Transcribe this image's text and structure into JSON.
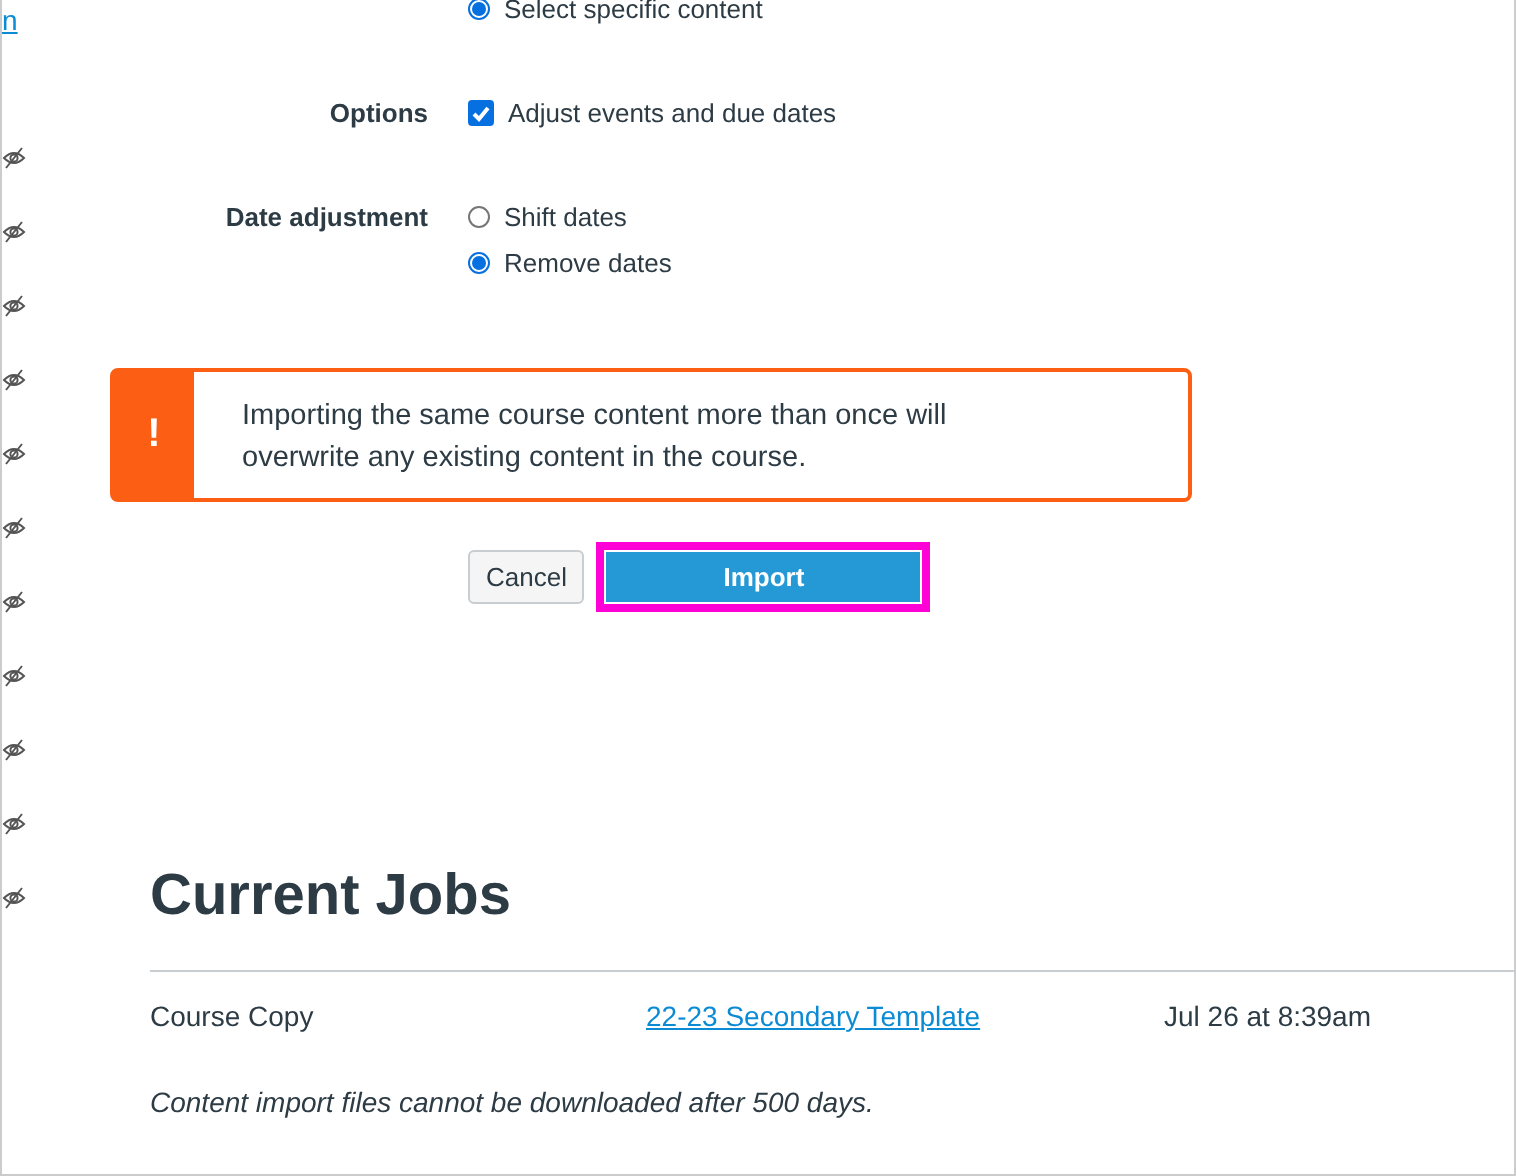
{
  "sidebar": {
    "link": "n",
    "items": [
      {
        "hidden": true
      },
      {
        "hidden": true
      },
      {
        "hidden": true
      },
      {
        "hidden": true
      },
      {
        "hidden": true
      },
      {
        "hidden": true
      },
      {
        "hidden": true
      },
      {
        "hidden": true
      },
      {
        "hidden": true
      },
      {
        "hidden": true
      },
      {
        "hidden": true
      }
    ]
  },
  "content_option": {
    "label": "Select specific content",
    "selected": true
  },
  "options": {
    "label": "Options",
    "checkbox": {
      "label": "Adjust events and due dates",
      "checked": true
    }
  },
  "date_adjustment": {
    "label": "Date adjustment",
    "choices": [
      {
        "label": "Shift dates",
        "selected": false
      },
      {
        "label": "Remove dates",
        "selected": true
      }
    ]
  },
  "alert": {
    "icon": "!",
    "message": "Importing the same course content more than once will overwrite any existing content in the course."
  },
  "buttons": {
    "cancel": "Cancel",
    "import": "Import",
    "import_focused": true
  },
  "jobs": {
    "title": "Current Jobs",
    "rows": [
      {
        "type": "Course Copy",
        "source": "22-23 Secondary Template",
        "date": "Jul 26 at 8:39am"
      }
    ],
    "note": "Content import files cannot be downloaded after 500 days."
  }
}
